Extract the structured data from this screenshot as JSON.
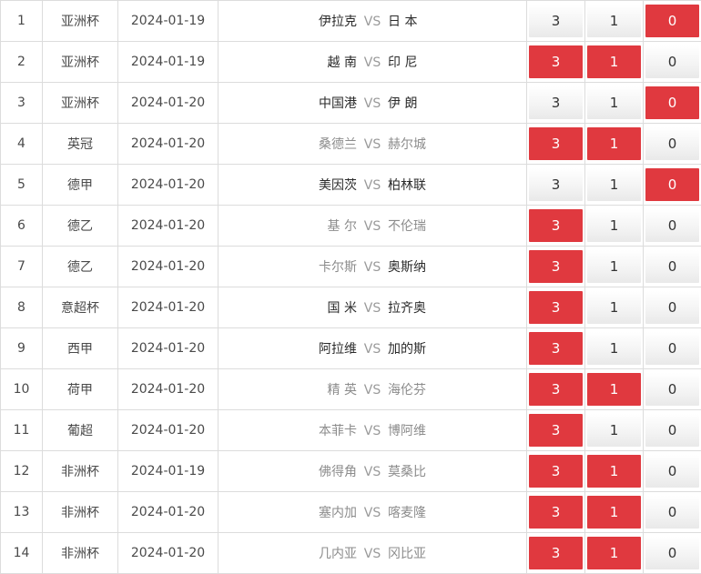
{
  "colors": {
    "selected": "#e0393f",
    "text": "#333333",
    "muted": "#8c8c8c",
    "border": "#dcdcdc"
  },
  "rows": [
    {
      "no": "1",
      "league": "亚洲杯",
      "date": "2024-01-19",
      "home": "伊拉克",
      "vs": "VS",
      "away": "日 本",
      "options": [
        {
          "label": "3",
          "selected": false
        },
        {
          "label": "1",
          "selected": false
        },
        {
          "label": "0",
          "selected": true
        }
      ],
      "dim_home": false,
      "dim_away": false
    },
    {
      "no": "2",
      "league": "亚洲杯",
      "date": "2024-01-19",
      "home": "越 南",
      "vs": "VS",
      "away": "印 尼",
      "options": [
        {
          "label": "3",
          "selected": true
        },
        {
          "label": "1",
          "selected": true
        },
        {
          "label": "0",
          "selected": false
        }
      ],
      "dim_home": false,
      "dim_away": false
    },
    {
      "no": "3",
      "league": "亚洲杯",
      "date": "2024-01-20",
      "home": "中国港",
      "vs": "VS",
      "away": "伊 朗",
      "options": [
        {
          "label": "3",
          "selected": false
        },
        {
          "label": "1",
          "selected": false
        },
        {
          "label": "0",
          "selected": true
        }
      ],
      "dim_home": false,
      "dim_away": false
    },
    {
      "no": "4",
      "league": "英冠",
      "date": "2024-01-20",
      "home": "桑德兰",
      "vs": "VS",
      "away": "赫尔城",
      "options": [
        {
          "label": "3",
          "selected": true
        },
        {
          "label": "1",
          "selected": true
        },
        {
          "label": "0",
          "selected": false
        }
      ],
      "dim_home": true,
      "dim_away": true
    },
    {
      "no": "5",
      "league": "德甲",
      "date": "2024-01-20",
      "home": "美因茨",
      "vs": "VS",
      "away": "柏林联",
      "options": [
        {
          "label": "3",
          "selected": false
        },
        {
          "label": "1",
          "selected": false
        },
        {
          "label": "0",
          "selected": true
        }
      ],
      "dim_home": false,
      "dim_away": false
    },
    {
      "no": "6",
      "league": "德乙",
      "date": "2024-01-20",
      "home": "基 尔",
      "vs": "VS",
      "away": "不伦瑞",
      "options": [
        {
          "label": "3",
          "selected": true
        },
        {
          "label": "1",
          "selected": false
        },
        {
          "label": "0",
          "selected": false
        }
      ],
      "dim_home": true,
      "dim_away": true
    },
    {
      "no": "7",
      "league": "德乙",
      "date": "2024-01-20",
      "home": "卡尔斯",
      "vs": "VS",
      "away": "奥斯纳",
      "options": [
        {
          "label": "3",
          "selected": true
        },
        {
          "label": "1",
          "selected": false
        },
        {
          "label": "0",
          "selected": false
        }
      ],
      "dim_home": true,
      "dim_away": false
    },
    {
      "no": "8",
      "league": "意超杯",
      "date": "2024-01-20",
      "home": "国 米",
      "vs": "VS",
      "away": "拉齐奥",
      "options": [
        {
          "label": "3",
          "selected": true
        },
        {
          "label": "1",
          "selected": false
        },
        {
          "label": "0",
          "selected": false
        }
      ],
      "dim_home": false,
      "dim_away": false
    },
    {
      "no": "9",
      "league": "西甲",
      "date": "2024-01-20",
      "home": "阿拉维",
      "vs": "VS",
      "away": "加的斯",
      "options": [
        {
          "label": "3",
          "selected": true
        },
        {
          "label": "1",
          "selected": false
        },
        {
          "label": "0",
          "selected": false
        }
      ],
      "dim_home": false,
      "dim_away": false
    },
    {
      "no": "10",
      "league": "荷甲",
      "date": "2024-01-20",
      "home": "精 英",
      "vs": "VS",
      "away": "海伦芬",
      "options": [
        {
          "label": "3",
          "selected": true
        },
        {
          "label": "1",
          "selected": true
        },
        {
          "label": "0",
          "selected": false
        }
      ],
      "dim_home": true,
      "dim_away": true
    },
    {
      "no": "11",
      "league": "葡超",
      "date": "2024-01-20",
      "home": "本菲卡",
      "vs": "VS",
      "away": "博阿维",
      "options": [
        {
          "label": "3",
          "selected": true
        },
        {
          "label": "1",
          "selected": false
        },
        {
          "label": "0",
          "selected": false
        }
      ],
      "dim_home": true,
      "dim_away": true
    },
    {
      "no": "12",
      "league": "非洲杯",
      "date": "2024-01-19",
      "home": "佛得角",
      "vs": "VS",
      "away": "莫桑比",
      "options": [
        {
          "label": "3",
          "selected": true
        },
        {
          "label": "1",
          "selected": true
        },
        {
          "label": "0",
          "selected": false
        }
      ],
      "dim_home": true,
      "dim_away": true
    },
    {
      "no": "13",
      "league": "非洲杯",
      "date": "2024-01-20",
      "home": "塞内加",
      "vs": "VS",
      "away": "喀麦隆",
      "options": [
        {
          "label": "3",
          "selected": true
        },
        {
          "label": "1",
          "selected": true
        },
        {
          "label": "0",
          "selected": false
        }
      ],
      "dim_home": true,
      "dim_away": true
    },
    {
      "no": "14",
      "league": "非洲杯",
      "date": "2024-01-20",
      "home": "几内亚",
      "vs": "VS",
      "away": "冈比亚",
      "options": [
        {
          "label": "3",
          "selected": true
        },
        {
          "label": "1",
          "selected": true
        },
        {
          "label": "0",
          "selected": false
        }
      ],
      "dim_home": true,
      "dim_away": true
    }
  ]
}
